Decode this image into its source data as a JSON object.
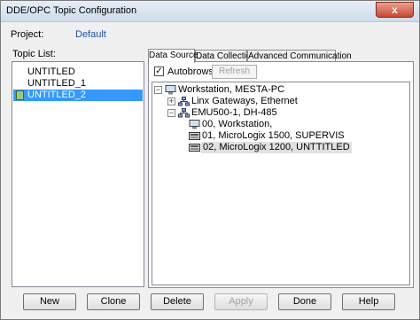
{
  "window": {
    "title": "DDE/OPC Topic Configuration",
    "close_glyph": "x"
  },
  "project": {
    "label": "Project:",
    "value": "Default"
  },
  "topic_list": {
    "label": "Topic List:",
    "items": [
      "UNTITLED",
      "UNTITLED_1",
      "UNTITLED_2"
    ],
    "selected": "UNTITLED_2"
  },
  "tabs": [
    "Data Source",
    "Data Collection",
    "Advanced Communication"
  ],
  "active_tab": "Data Source",
  "autobrowse": {
    "label": "Autobrowse",
    "checked": true,
    "check_glyph": "✓"
  },
  "refresh_label": "Refresh",
  "tree": {
    "root": "Workstation, MESTA-PC",
    "gateways": "Linx Gateways, Ethernet",
    "driver": "EMU500-1, DH-485",
    "stations": [
      "00, Workstation,",
      "01, MicroLogix 1500, SUPERVIS",
      "02, MicroLogix 1200, UNTTITLED"
    ],
    "selected_station": "02, MicroLogix 1200, UNTTITLED"
  },
  "buttons": {
    "new": "New",
    "clone": "Clone",
    "delete": "Delete",
    "apply": "Apply",
    "done": "Done",
    "help": "Help"
  },
  "expander_glyphs": {
    "minus": "−",
    "plus": "+"
  }
}
